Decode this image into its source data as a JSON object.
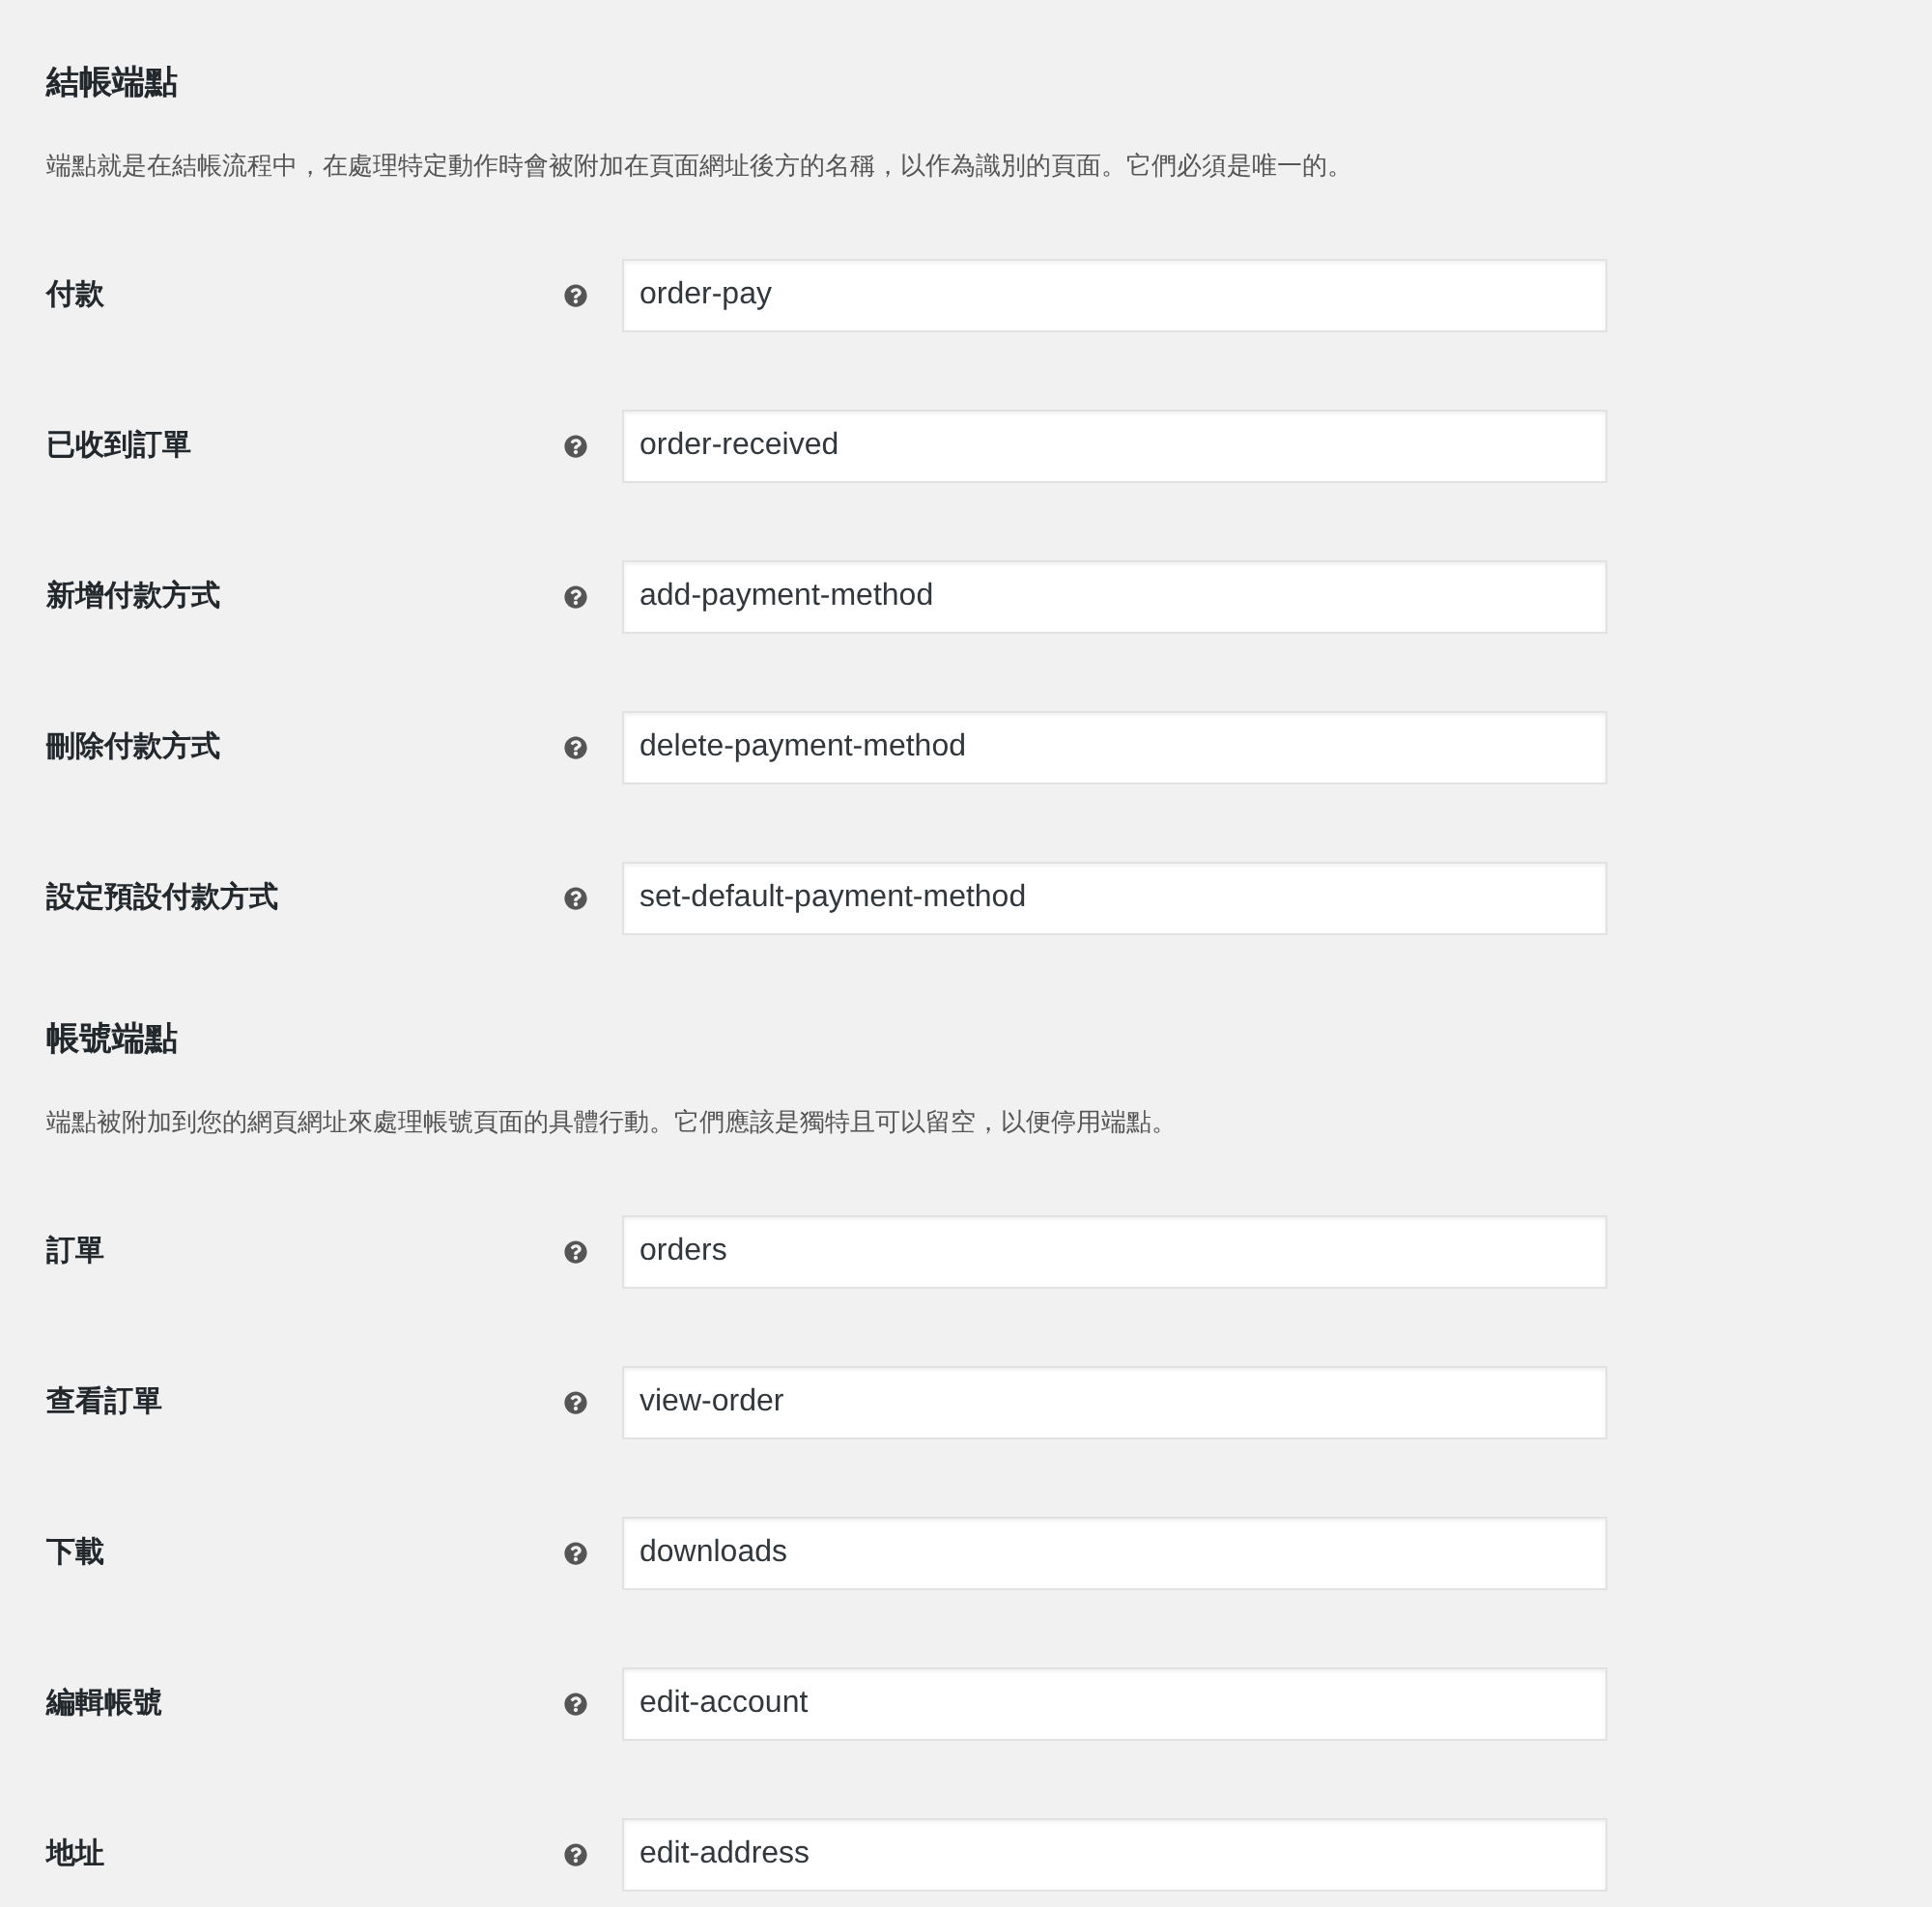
{
  "sections": [
    {
      "title": "結帳端點",
      "description": "端點就是在結帳流程中，在處理特定動作時會被附加在頁面網址後方的名稱，以作為識別的頁面。它們必須是唯一的。",
      "fields": [
        {
          "label": "付款",
          "value": "order-pay"
        },
        {
          "label": "已收到訂單",
          "value": "order-received"
        },
        {
          "label": "新增付款方式",
          "value": "add-payment-method"
        },
        {
          "label": "刪除付款方式",
          "value": "delete-payment-method"
        },
        {
          "label": "設定預設付款方式",
          "value": "set-default-payment-method"
        }
      ]
    },
    {
      "title": "帳號端點",
      "description": "端點被附加到您的網頁網址來處理帳號頁面的具體行動。它們應該是獨特且可以留空，以便停用端點。",
      "fields": [
        {
          "label": "訂單",
          "value": "orders"
        },
        {
          "label": "查看訂單",
          "value": "view-order"
        },
        {
          "label": "下載",
          "value": "downloads"
        },
        {
          "label": "編輯帳號",
          "value": "edit-account"
        },
        {
          "label": "地址",
          "value": "edit-address"
        }
      ]
    }
  ]
}
